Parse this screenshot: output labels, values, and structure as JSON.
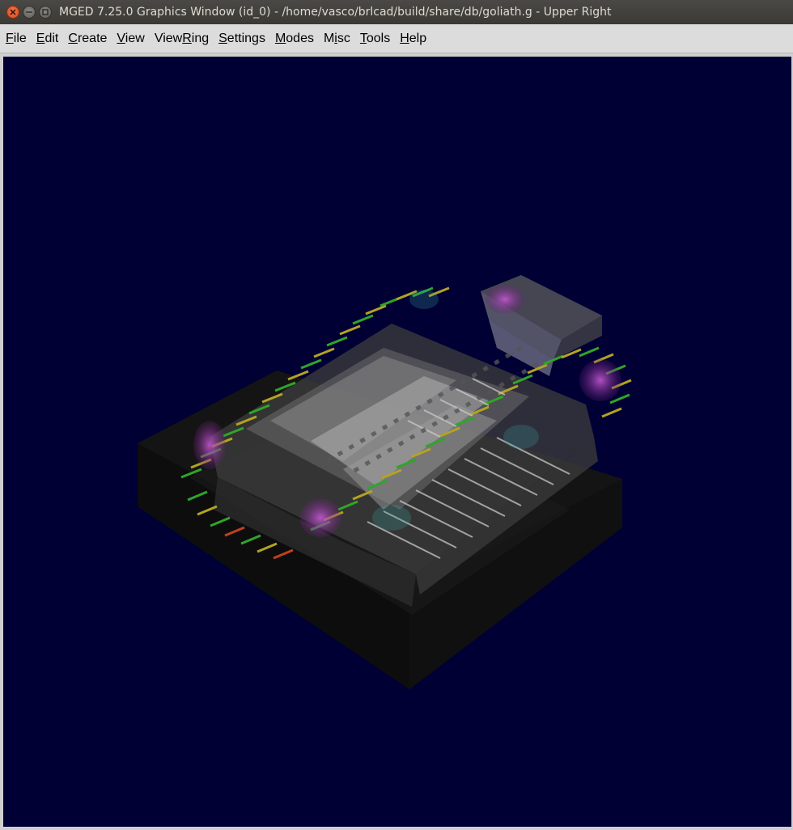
{
  "window": {
    "title": "MGED 7.25.0 Graphics Window (id_0) - /home/vasco/brlcad/build/share/db/goliath.g - Upper Right"
  },
  "menubar": {
    "items": [
      {
        "pre": "",
        "u": "F",
        "post": "ile"
      },
      {
        "pre": "",
        "u": "E",
        "post": "dit"
      },
      {
        "pre": "",
        "u": "C",
        "post": "reate"
      },
      {
        "pre": "",
        "u": "V",
        "post": "iew"
      },
      {
        "pre": "View",
        "u": "R",
        "post": "ing"
      },
      {
        "pre": "",
        "u": "S",
        "post": "ettings"
      },
      {
        "pre": "",
        "u": "M",
        "post": "odes"
      },
      {
        "pre": "M",
        "u": "i",
        "post": "sc"
      },
      {
        "pre": "",
        "u": "T",
        "post": "ools"
      },
      {
        "pre": "",
        "u": "H",
        "post": "elp"
      }
    ]
  },
  "colors": {
    "viewport_background": "#000034",
    "accent_tread_green": "#2fa52a",
    "accent_tread_yellow": "#b3a322",
    "accent_wheel_magenta": "#a23fb0"
  },
  "icons": {
    "close": "close-icon",
    "minimize": "minimize-icon",
    "maximize": "maximize-icon"
  }
}
